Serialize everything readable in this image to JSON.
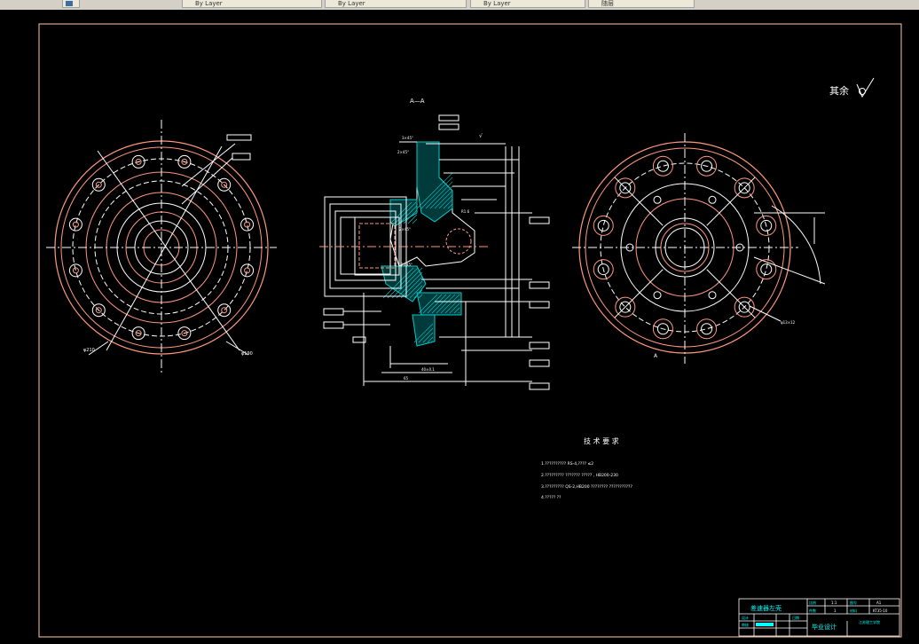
{
  "toolbar": {
    "buttons": [
      "",
      "By Layer",
      "By Layer",
      "By Layer",
      "随层"
    ]
  },
  "drawing": {
    "section_label": "A—A",
    "roughness_note": "其余",
    "tech_title": "技 术 要 求",
    "tech_lines": [
      "1.??????????  RS-4,????  ≤2",
      "2.?????????  ???????  ?????  ,  HB200-230",
      "3.?????????  QS-2,HB200 ????????  ???????????"
    ],
    "tech_line4": "4.?????  ??",
    "view_letter": "A",
    "title_block": {
      "part_name": "差速器左壳",
      "design_type": "毕业设计",
      "scale_label": "比例",
      "scale_value": "1:1",
      "qty_label": "件数",
      "qty_value": "1",
      "drawing_no_label": "图号",
      "drawing_no_value": "A1",
      "material_label": "材料",
      "material_value": "KT35-10",
      "school": "江苏理工学院",
      "designer_label": "设计",
      "checker_label": "审核",
      "date_label": "日期"
    },
    "dims": {
      "d1": "φ210",
      "d2": "φ190",
      "d3": "φ13×12",
      "d4": "φ160",
      "d5": "R1.6"
    }
  },
  "colors": {
    "background": "#000000",
    "border": "#ffc9a8",
    "white": "#ffffff",
    "salmon": "#ff9980",
    "cyan": "#00ffff",
    "hatch": "#00cccc"
  }
}
